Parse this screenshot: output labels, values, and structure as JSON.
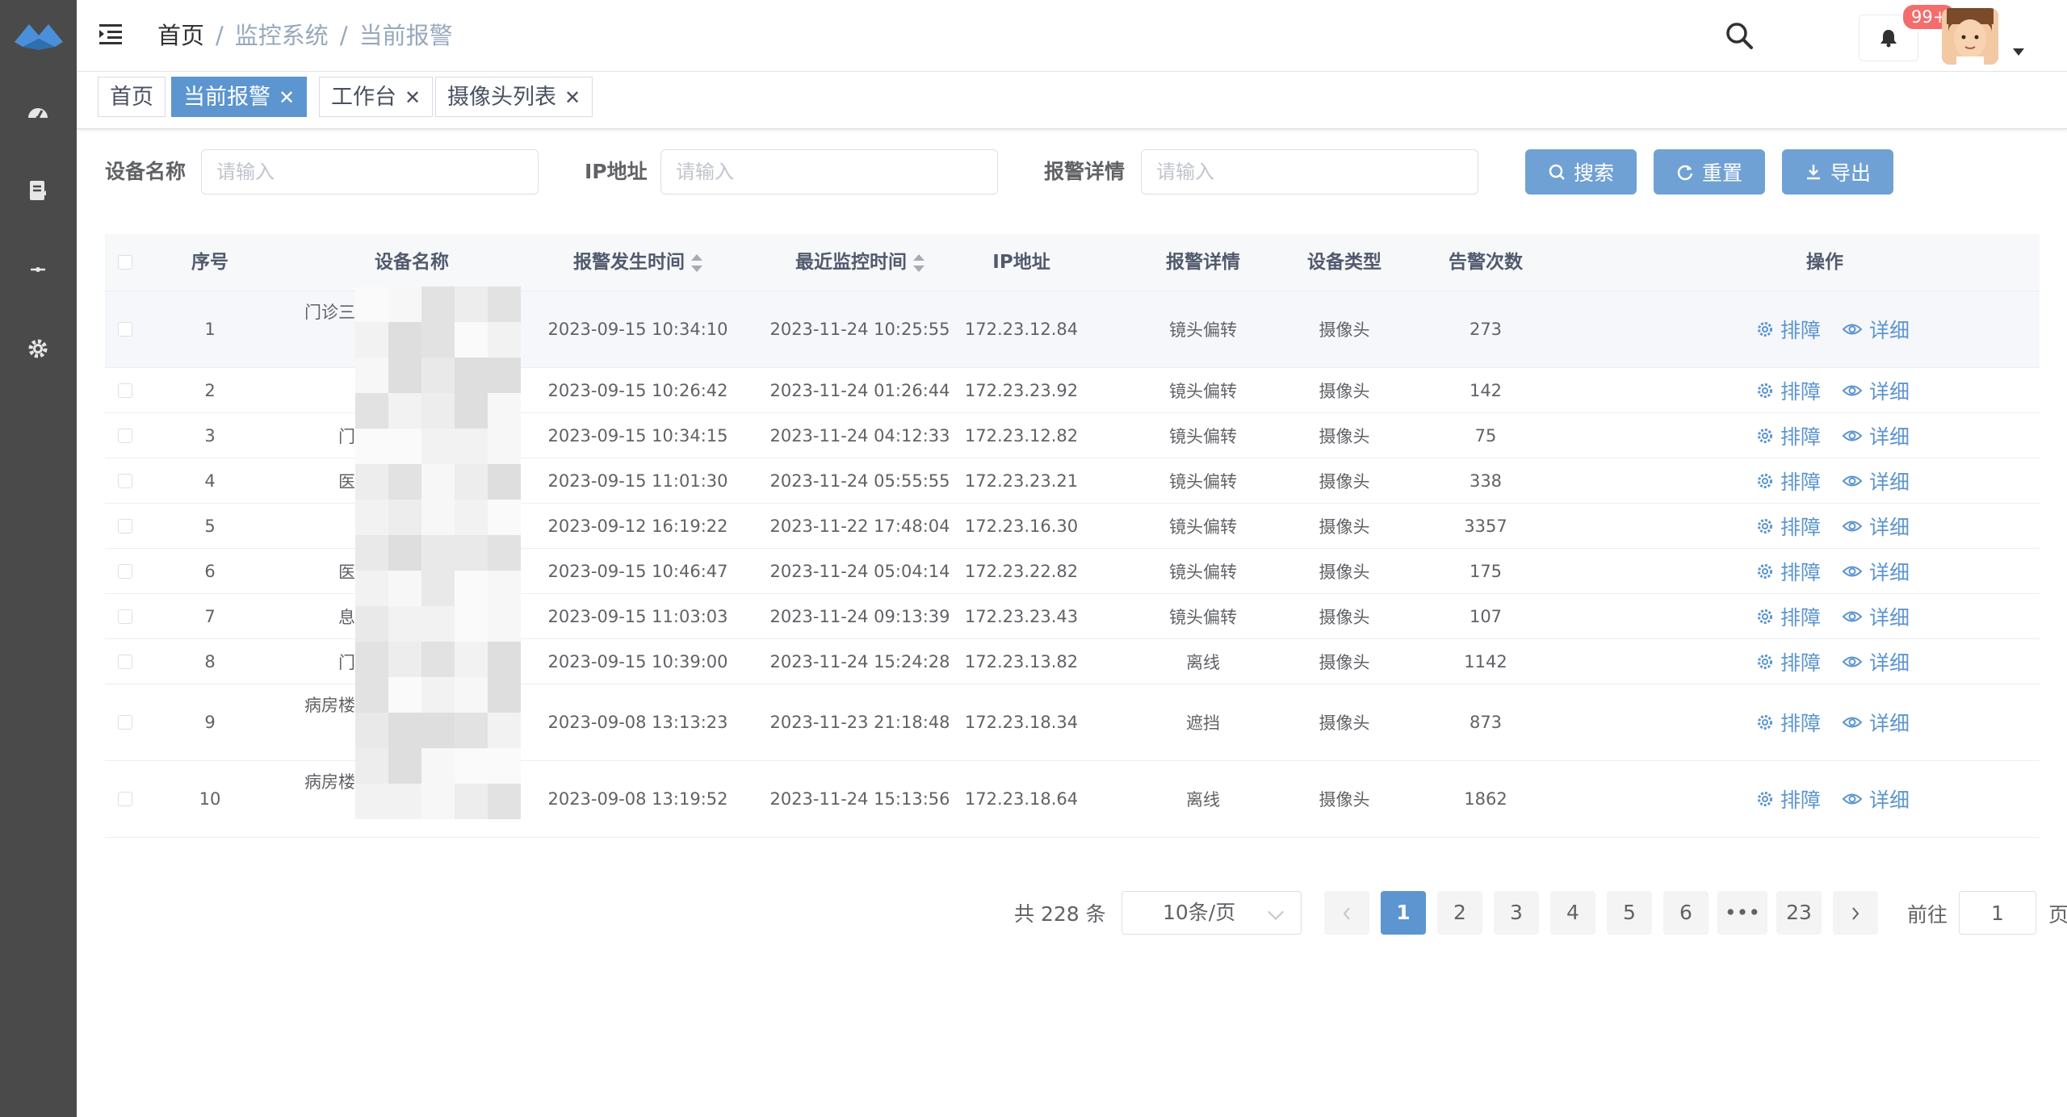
{
  "header": {
    "breadcrumb": [
      "首页",
      "监控系统",
      "当前报警"
    ],
    "badge": "99+"
  },
  "tags": [
    {
      "label": "首页",
      "closable": false,
      "active": false
    },
    {
      "label": "当前报警",
      "closable": true,
      "active": true
    },
    {
      "label": "工作台",
      "closable": true,
      "active": false
    },
    {
      "label": "摄像头列表",
      "closable": true,
      "active": false
    }
  ],
  "search": {
    "device_label": "设备名称",
    "device_placeholder": "请输入",
    "ip_label": "IP地址",
    "ip_placeholder": "请输入",
    "detail_label": "报警详情",
    "detail_placeholder": "请输入",
    "search_btn": "搜索",
    "reset_btn": "重置",
    "export_btn": "导出"
  },
  "table": {
    "headers": [
      "序号",
      "设备名称",
      "报警发生时间",
      "最近监控时间",
      "IP地址",
      "报警详情",
      "设备类型",
      "告警次数",
      "操作"
    ],
    "op_fix": "排障",
    "op_detail": "详细",
    "rows": [
      {
        "no": "1",
        "name": "门诊三",
        "alarm_time": "2023-09-15 10:34:10",
        "monitor_time": "2023-11-24 10:25:55",
        "ip": "172.23.12.84",
        "detail": "镜头偏转",
        "type": "摄像头",
        "count": "273"
      },
      {
        "no": "2",
        "name": "",
        "alarm_time": "2023-09-15 10:26:42",
        "monitor_time": "2023-11-24 01:26:44",
        "ip": "172.23.23.92",
        "detail": "镜头偏转",
        "type": "摄像头",
        "count": "142"
      },
      {
        "no": "3",
        "name": "门",
        "alarm_time": "2023-09-15 10:34:15",
        "monitor_time": "2023-11-24 04:12:33",
        "ip": "172.23.12.82",
        "detail": "镜头偏转",
        "type": "摄像头",
        "count": "75"
      },
      {
        "no": "4",
        "name": "医",
        "alarm_time": "2023-09-15 11:01:30",
        "monitor_time": "2023-11-24 05:55:55",
        "ip": "172.23.23.21",
        "detail": "镜头偏转",
        "type": "摄像头",
        "count": "338"
      },
      {
        "no": "5",
        "name": "",
        "alarm_time": "2023-09-12 16:19:22",
        "monitor_time": "2023-11-22 17:48:04",
        "ip": "172.23.16.30",
        "detail": "镜头偏转",
        "type": "摄像头",
        "count": "3357"
      },
      {
        "no": "6",
        "name": "医",
        "alarm_time": "2023-09-15 10:46:47",
        "monitor_time": "2023-11-24 05:04:14",
        "ip": "172.23.22.82",
        "detail": "镜头偏转",
        "type": "摄像头",
        "count": "175"
      },
      {
        "no": "7",
        "name": "息",
        "alarm_time": "2023-09-15 11:03:03",
        "monitor_time": "2023-11-24 09:13:39",
        "ip": "172.23.23.43",
        "detail": "镜头偏转",
        "type": "摄像头",
        "count": "107"
      },
      {
        "no": "8",
        "name": "门",
        "alarm_time": "2023-09-15 10:39:00",
        "monitor_time": "2023-11-24 15:24:28",
        "ip": "172.23.13.82",
        "detail": "离线",
        "type": "摄像头",
        "count": "1142"
      },
      {
        "no": "9",
        "name": "病房楼",
        "alarm_time": "2023-09-08 13:13:23",
        "monitor_time": "2023-11-23 21:18:48",
        "ip": "172.23.18.34",
        "detail": "遮挡",
        "type": "摄像头",
        "count": "873"
      },
      {
        "no": "10",
        "name": "病房楼",
        "alarm_time": "2023-09-08 13:19:52",
        "monitor_time": "2023-11-24 15:13:56",
        "ip": "172.23.18.64",
        "detail": "离线",
        "type": "摄像头",
        "count": "1862"
      }
    ]
  },
  "pagination": {
    "total": "共 228 条",
    "page_size": "10条/页",
    "pages": [
      "1",
      "2",
      "3",
      "4",
      "5",
      "6",
      "•••",
      "23"
    ],
    "current": "1",
    "goto_label": "前往",
    "goto_value": "1",
    "goto_suffix": "页"
  },
  "colors": {
    "sidebar": "#4a4a4a",
    "primary": "#5c95cf",
    "button": "#6fa1d4",
    "badge": "#f56c6c"
  },
  "icons": [
    "logo-icon",
    "dashboard-icon",
    "document-icon",
    "collapse-icon",
    "gear-icon",
    "search-icon",
    "bell-icon",
    "avatar",
    "refresh-icon",
    "download-icon",
    "eye-icon",
    "chevron-left-icon",
    "chevron-right-icon"
  ]
}
